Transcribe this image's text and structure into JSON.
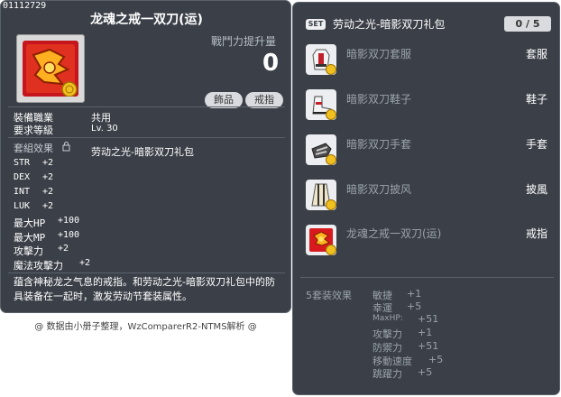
{
  "item": {
    "id": "01112729",
    "title": "龙魂之戒一双刀(运)",
    "power_label": "戰鬥力提升量",
    "power_value": "0",
    "tags": [
      "飾品",
      "戒指"
    ],
    "job_label": "裝備職業",
    "job_value": "共用",
    "level_label": "要求等級",
    "level_value": "Lv. 30",
    "set_label": "套組效果",
    "set_name": "劳动之光-暗影双刀礼包",
    "stats": [
      {
        "name": "STR",
        "value": "+2"
      },
      {
        "name": "DEX",
        "value": "+2"
      },
      {
        "name": "INT",
        "value": "+2"
      },
      {
        "name": "LUK",
        "value": "+2"
      },
      {
        "name": "最大HP",
        "value": "+100"
      },
      {
        "name": "最大MP",
        "value": "+100"
      },
      {
        "name": "攻擊力",
        "value": "+2"
      },
      {
        "name": "魔法攻擊力",
        "value": "+2"
      }
    ],
    "description": "蕴含神秘龙之气息的戒指。和劳动之光-暗影双刀礼包中的防具装备在一起时，激发劳动节套装属性。"
  },
  "footer": "@ 数据由小册子整理，WzComparerR2-NTMS解析 @",
  "set_panel": {
    "badge": "SET",
    "title": "劳动之光-暗影双刀礼包",
    "count": "0 / 5",
    "pieces": [
      {
        "name": "暗影双刀套服",
        "slot": "套服",
        "icon": "outfit-icon"
      },
      {
        "name": "暗影双刀鞋子",
        "slot": "鞋子",
        "icon": "shoes-icon"
      },
      {
        "name": "暗影双刀手套",
        "slot": "手套",
        "icon": "gloves-icon"
      },
      {
        "name": "暗影双刀披风",
        "slot": "披風",
        "icon": "cape-icon"
      },
      {
        "name": "龙魂之戒一双刀(运)",
        "slot": "戒指",
        "icon": "ring-icon"
      }
    ],
    "effect_label": "5套装效果",
    "effects": [
      {
        "name": "敏捷",
        "value": "+1"
      },
      {
        "name": "幸運",
        "value": "+5"
      },
      {
        "name": "MaxHP:",
        "value": "+51"
      },
      {
        "name": "攻擊力",
        "value": "+1"
      },
      {
        "name": "防禦力",
        "value": "+51"
      },
      {
        "name": "移動速度",
        "value": "+5"
      },
      {
        "name": "跳躍力",
        "value": "+5"
      }
    ]
  },
  "colors": {
    "panel": "#3b4048",
    "muted_text": "#9ca2aa",
    "coin": "#f0c020"
  }
}
